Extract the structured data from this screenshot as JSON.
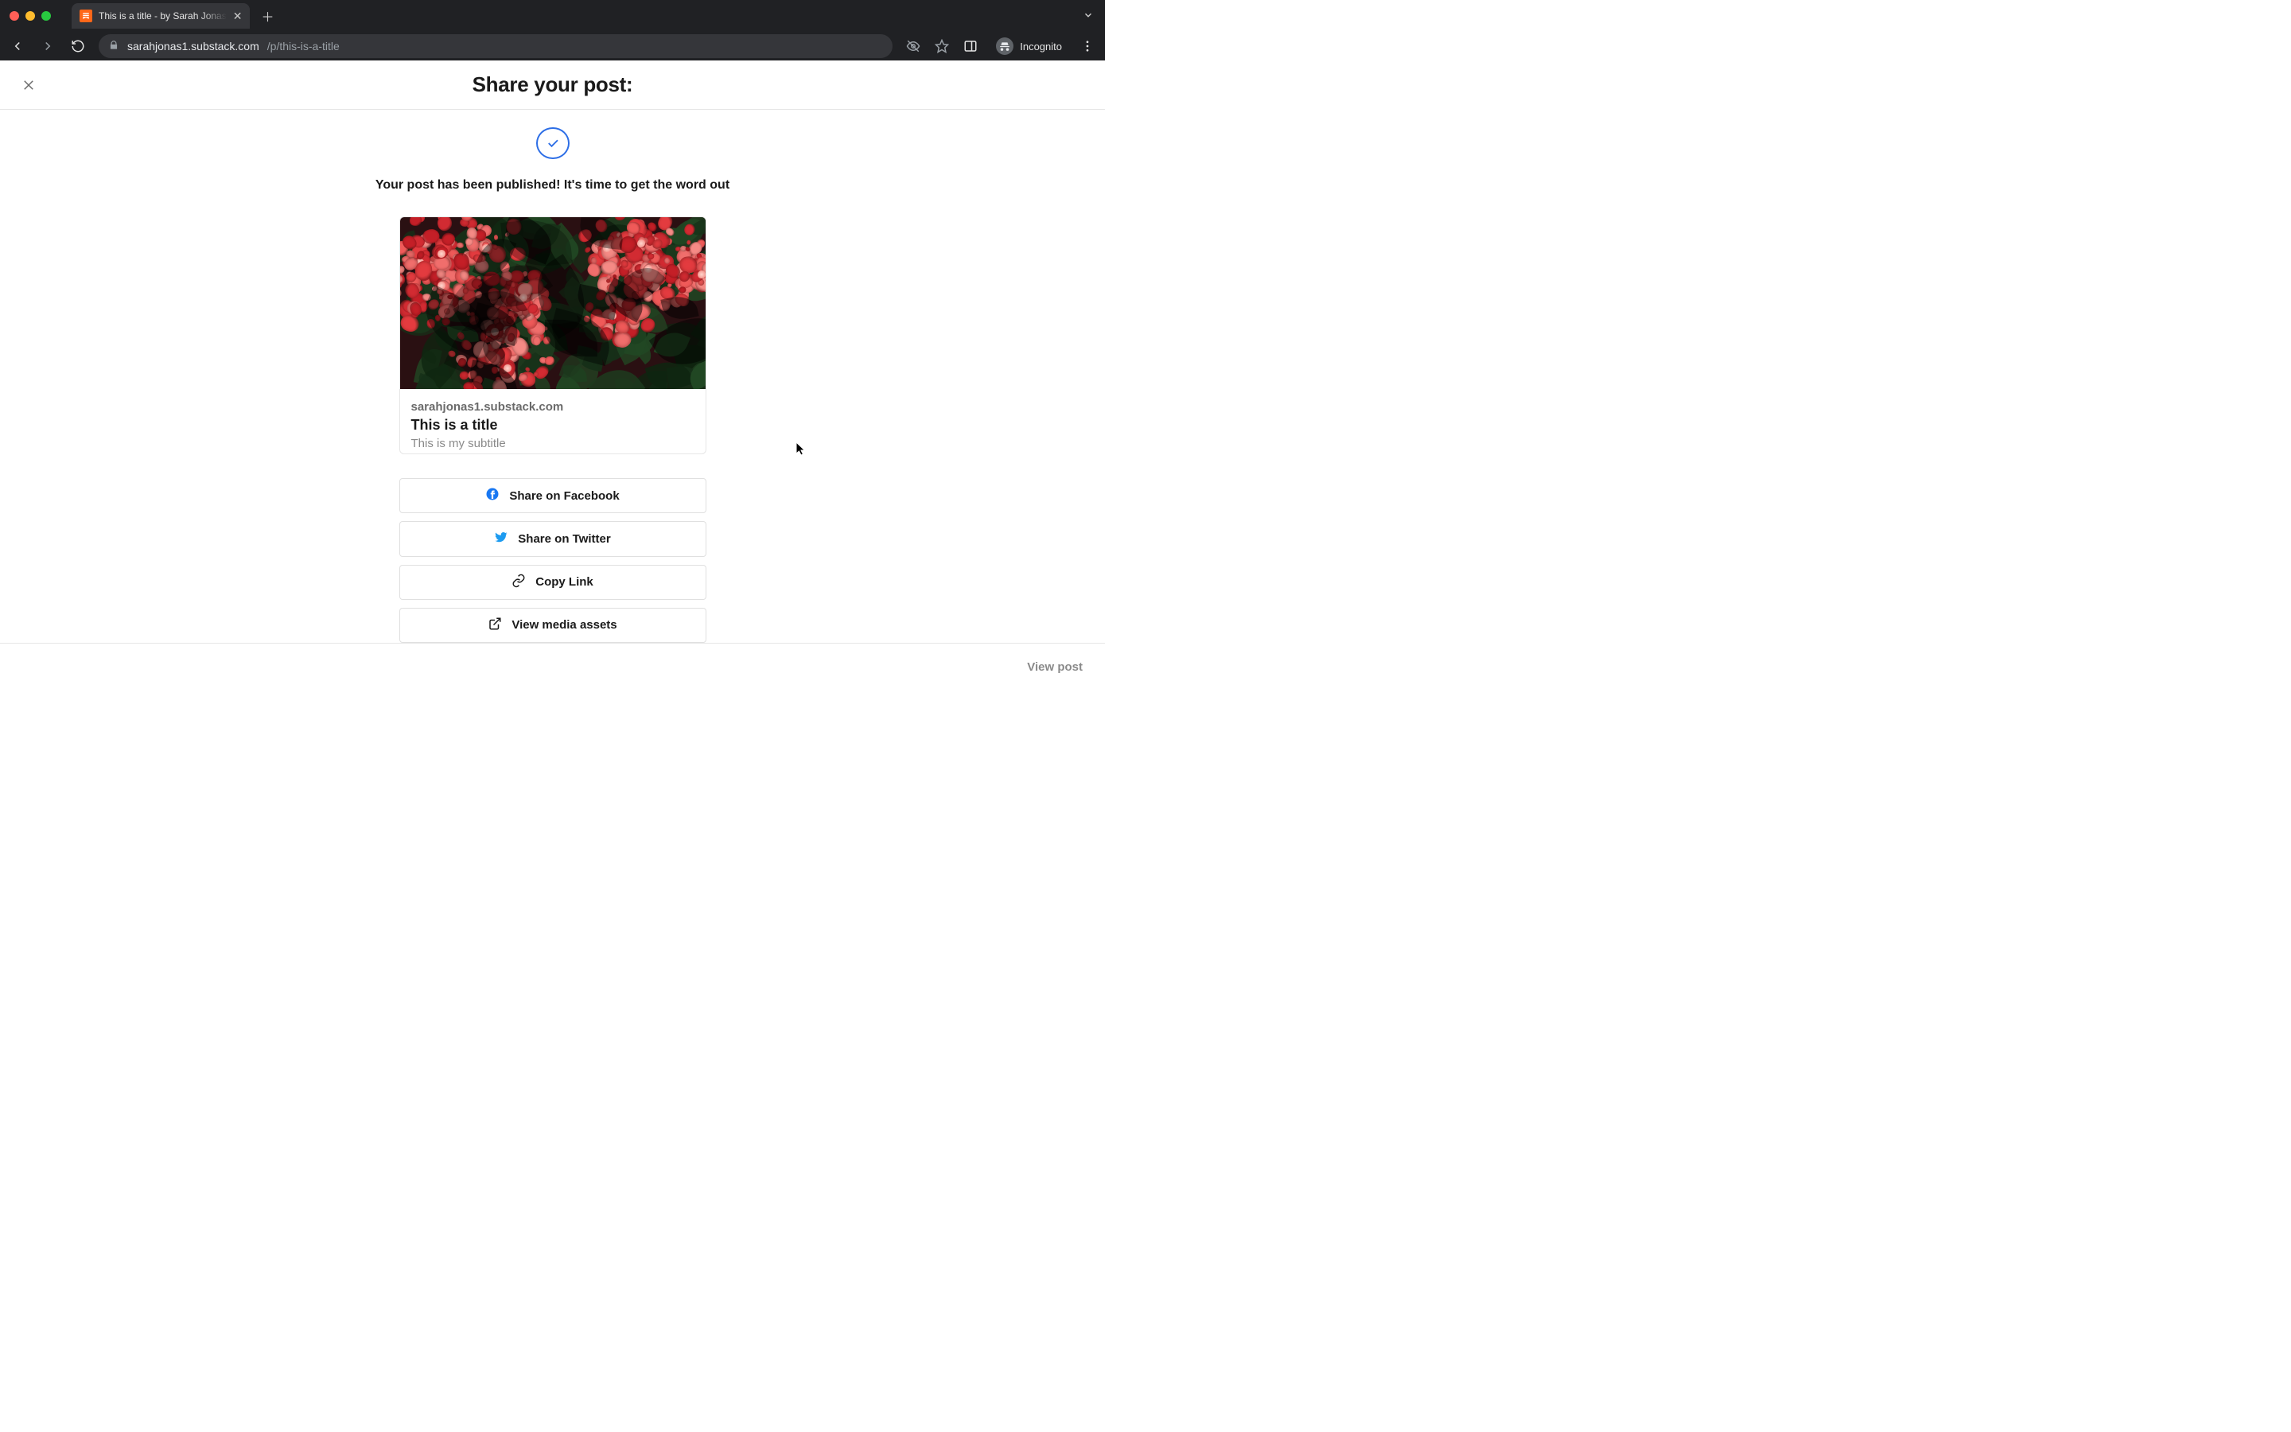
{
  "browser": {
    "tab": {
      "title": "This is a title - by Sarah Jonas"
    },
    "url_host": "sarahjonas1.substack.com",
    "url_path": "/p/this-is-a-title",
    "incognito_label": "Incognito"
  },
  "header": {
    "page_title": "Share your post:"
  },
  "main": {
    "published_message": "Your post has been published! It's time to get the word out",
    "card": {
      "domain": "sarahjonas1.substack.com",
      "title": "This is a title",
      "subtitle": "This is my subtitle"
    },
    "share_buttons": {
      "facebook": "Share on Facebook",
      "twitter": "Share on Twitter",
      "copy": "Copy Link",
      "media": "View media assets"
    },
    "icons": {
      "facebook_color": "#1877f2",
      "twitter_color": "#1d9bf0"
    }
  },
  "footer": {
    "view_post": "View post"
  }
}
